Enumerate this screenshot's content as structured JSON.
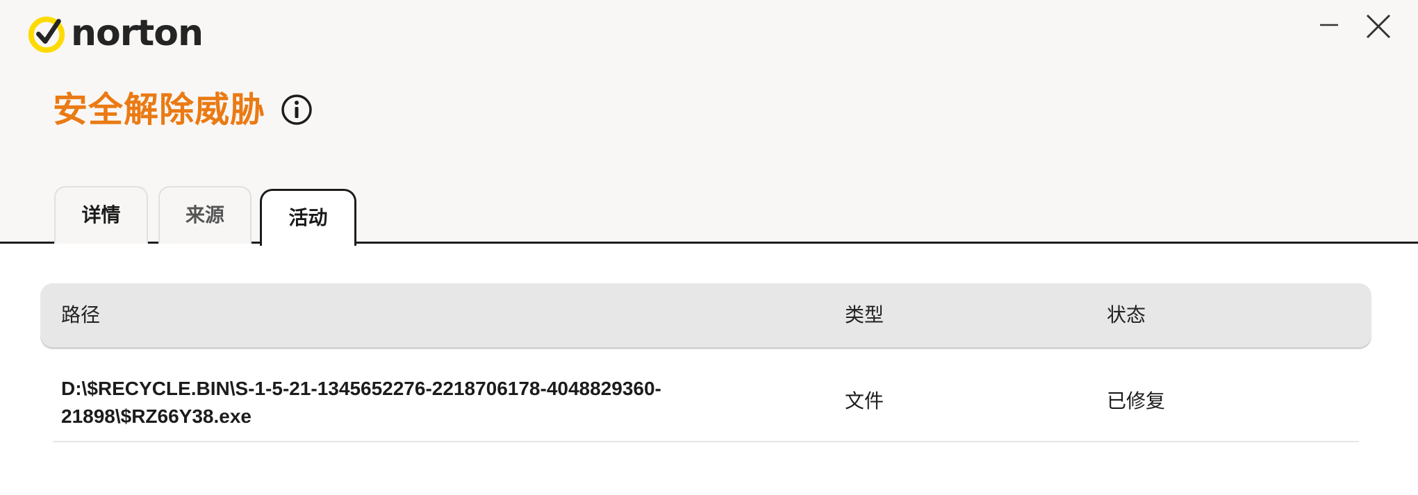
{
  "app": {
    "logo_text": "norton",
    "colors": {
      "accent": "#ea7a14",
      "logo_yellow": "#fedb00"
    }
  },
  "window_controls": {
    "minimize_icon": "minimize-icon",
    "close_icon": "close-icon"
  },
  "page": {
    "title": "安全解除威胁",
    "info_icon": "info-icon"
  },
  "tabs": [
    {
      "label": "详情",
      "selected": false
    },
    {
      "label": "来源",
      "selected": false
    },
    {
      "label": "活动",
      "selected": true
    }
  ],
  "table": {
    "columns": [
      "路径",
      "类型",
      "状态"
    ],
    "rows": [
      {
        "path_line1": "D:\\$RECYCLE.BIN\\S-1-5-21-1345652276-2218706178-4048829360-",
        "path_line2": "21898\\$RZ66Y38.exe",
        "type": "文件",
        "status": "已修复"
      }
    ]
  }
}
